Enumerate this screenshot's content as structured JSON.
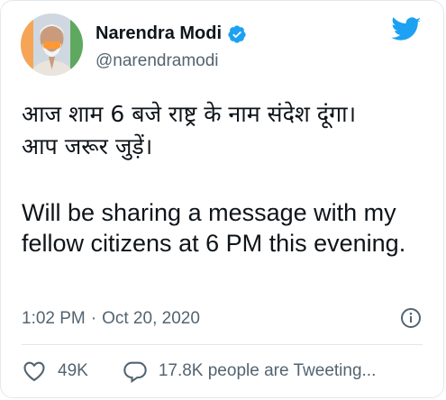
{
  "author": {
    "display_name": "Narendra Modi",
    "handle": "@narendramodi",
    "verified": true
  },
  "icons": {
    "avatar": "profile-photo",
    "verified": "verified-badge-icon",
    "brand": "twitter-bird-icon",
    "info": "info-icon",
    "like": "heart-icon",
    "reply": "reply-bubble-icon"
  },
  "colors": {
    "brand": "#1da1f2",
    "text": "#0f1419",
    "muted": "#536471",
    "border": "#e1e8ed"
  },
  "tweet": {
    "hindi_line1": "आज शाम 6 बजे राष्ट्र के नाम संदेश दूंगा।",
    "hindi_line2": "आप जरूर जुड़ें।",
    "english": "Will be sharing a message with my fellow citizens at 6 PM this evening."
  },
  "meta": {
    "time": "1:02 PM",
    "separator": "·",
    "date": "Oct 20, 2020"
  },
  "stats": {
    "likes": "49K",
    "tweeting": "17.8K people are Tweeting..."
  }
}
